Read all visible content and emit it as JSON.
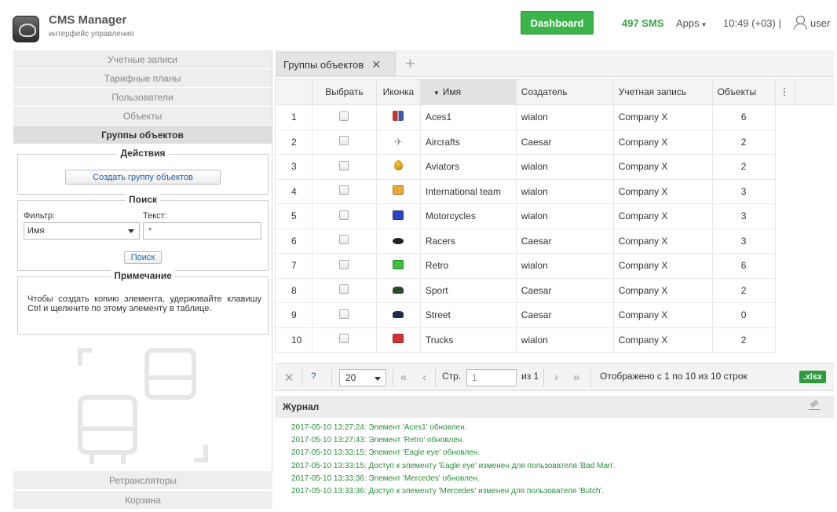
{
  "header": {
    "app_title": "CMS Manager",
    "app_subtitle": "интерфейс управления",
    "dashboard_label": "Dashboard",
    "sms_label": "497 SMS",
    "apps_label": "Apps",
    "clock": "10:49 (+03)",
    "separator": "|",
    "user_label": "user"
  },
  "sidebar": {
    "items": [
      {
        "label": "Учетные записи"
      },
      {
        "label": "Тарифные планы"
      },
      {
        "label": "Пользователи"
      },
      {
        "label": "Объекты"
      },
      {
        "label": "Группы объектов"
      }
    ],
    "bottom_items": [
      {
        "label": "Ретрансляторы"
      },
      {
        "label": "Корзина"
      }
    ],
    "actions": {
      "title": "Действия",
      "create_button": "Создать группу объектов"
    },
    "search": {
      "title": "Поиск",
      "filter_label": "Фильтр:",
      "filter_value": "Имя",
      "text_label": "Текст:",
      "text_value": "*",
      "search_button": "Поиск"
    },
    "note": {
      "title": "Примечание",
      "text": "Чтобы создать копию элемента, удерживайте клавишу Ctrl и щелкните по этому элементу в таблице."
    }
  },
  "tabs": {
    "active_label": "Группы объектов",
    "close_glyph": "✕",
    "add_glyph": "+"
  },
  "table": {
    "columns": {
      "select": "Выбрать",
      "icon": "Иконка",
      "name": "Имя",
      "creator": "Создатель",
      "account": "Учетная запись",
      "objects": "Объекты",
      "menu": "⋮"
    },
    "sort_glyph": "▼",
    "rows": [
      {
        "n": "1",
        "icon": "red-pair",
        "name": "Aces1",
        "creator": "wialon",
        "account": "Company X",
        "objects": "6"
      },
      {
        "n": "2",
        "icon": "plane",
        "name": "Aircrafts",
        "creator": "Caesar",
        "account": "Company X",
        "objects": "2"
      },
      {
        "n": "3",
        "icon": "balloon",
        "name": "Aviators",
        "creator": "wialon",
        "account": "Company X",
        "objects": "2"
      },
      {
        "n": "4",
        "icon": "box-orange",
        "name": "International team",
        "creator": "wialon",
        "account": "Company X",
        "objects": "3"
      },
      {
        "n": "5",
        "icon": "box-blue",
        "name": "Motorcycles",
        "creator": "wialon",
        "account": "Company X",
        "objects": "3"
      },
      {
        "n": "6",
        "icon": "rock",
        "name": "Racers",
        "creator": "Caesar",
        "account": "Company X",
        "objects": "3"
      },
      {
        "n": "7",
        "icon": "box-green",
        "name": "Retro",
        "creator": "wialon",
        "account": "Company X",
        "objects": "6"
      },
      {
        "n": "8",
        "icon": "car-dark",
        "name": "Sport",
        "creator": "Caesar",
        "account": "Company X",
        "objects": "2"
      },
      {
        "n": "9",
        "icon": "car-navy",
        "name": "Street",
        "creator": "Caesar",
        "account": "Company X",
        "objects": "0"
      },
      {
        "n": "10",
        "icon": "box-red",
        "name": "Trucks",
        "creator": "wialon",
        "account": "Company X",
        "objects": "2"
      }
    ]
  },
  "pager": {
    "clear_glyph": "✕",
    "help_glyph": "?",
    "page_size": "20",
    "first_glyph": "«",
    "prev_glyph": "‹",
    "page_label": "Стр.",
    "page_value": "1",
    "of_label": "из 1",
    "next_glyph": "›",
    "last_glyph": "»",
    "summary": "Отображено с 1 по 10 из 10 строк",
    "export_label": ".xlsx"
  },
  "journal": {
    "title": "Журнал",
    "entries": [
      "2017-05-10 13:27:24: Элемент 'Aces1' обновлен.",
      "2017-05-10 13:27:43: Элемент 'Retro' обновлен.",
      "2017-05-10 13:33:15: Элемент 'Eagle eye' обновлен.",
      "2017-05-10 13:33:15: Доступ к элементу 'Eagle eye' изменен для пользователя 'Bad Man'.",
      "2017-05-10 13:33:36: Элемент 'Mercedes' обновлен.",
      "2017-05-10 13:33:36: Доступ к элементу 'Mercedes' изменен для пользователя 'Butch'."
    ]
  },
  "colors": {
    "accent_green": "#3bb54a",
    "journal_green": "#2a8f3a",
    "link_blue": "#1f5fa8"
  }
}
